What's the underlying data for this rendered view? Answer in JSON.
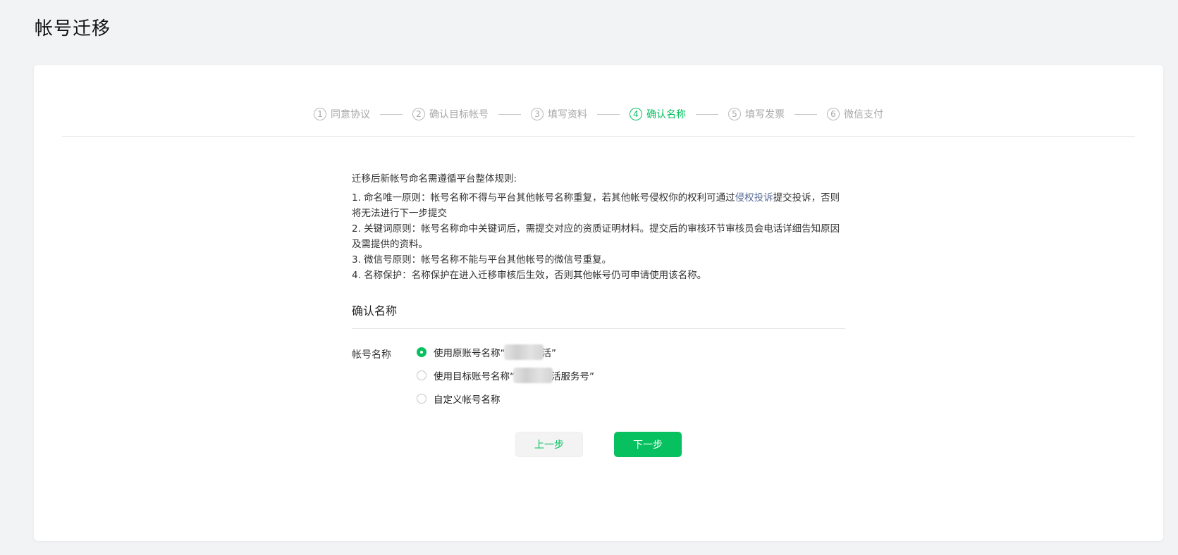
{
  "page": {
    "title": "帐号迁移"
  },
  "steps": [
    {
      "num": "1",
      "label": "同意协议"
    },
    {
      "num": "2",
      "label": "确认目标帐号"
    },
    {
      "num": "3",
      "label": "填写资料"
    },
    {
      "num": "4",
      "label": "确认名称"
    },
    {
      "num": "5",
      "label": "填写发票"
    },
    {
      "num": "6",
      "label": "微信支付"
    }
  ],
  "active_step": 4,
  "rules": {
    "intro": "迁移后新帐号命名需遵循平台整体规则:",
    "rule1_before": "1. 命名唯一原则：帐号名称不得与平台其他帐号名称重复，若其他帐号侵权你的权利可通过",
    "rule1_link": "侵权投诉",
    "rule1_after": "提交投诉，否则将无法进行下一步提交",
    "rule2": "2. 关键词原则：帐号名称命中关键词后，需提交对应的资质证明材料。提交后的审核环节审核员会电话详细告知原因及需提供的资料。",
    "rule3": "3. 微信号原则：帐号名称不能与平台其他帐号的微信号重复。",
    "rule4": "4. 名称保护：名称保护在进入迁移审核后生效，否则其他帐号仍可申请使用该名称。"
  },
  "confirm": {
    "section_title": "确认名称",
    "field_label": "帐号名称",
    "options": [
      {
        "prefix": "使用原账号名称“",
        "suffix": "活”",
        "checked": true
      },
      {
        "prefix": "使用目标账号名称“",
        "suffix": "活服务号”",
        "checked": false
      },
      {
        "prefix": "自定义帐号名称",
        "suffix": "",
        "checked": false
      }
    ]
  },
  "buttons": {
    "prev": "上一步",
    "next": "下一步"
  },
  "colors": {
    "accent": "#07c160",
    "link": "#576b95",
    "background": "#f2f3f5"
  }
}
